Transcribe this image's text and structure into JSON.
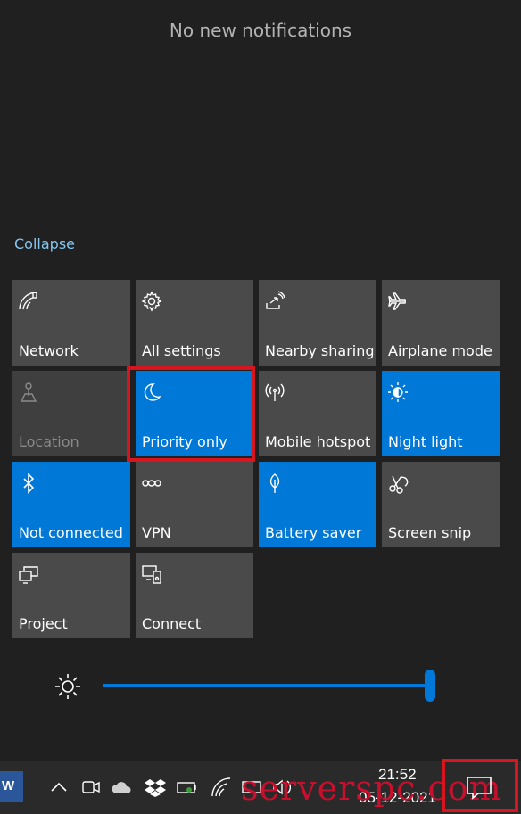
{
  "notifications": {
    "empty_text": "No new notifications"
  },
  "action_center": {
    "collapse_label": "Collapse"
  },
  "quick_actions": [
    {
      "label": "Network",
      "icon": "network-icon",
      "state": "off"
    },
    {
      "label": "All settings",
      "icon": "gear-icon",
      "state": "off"
    },
    {
      "label": "Nearby sharing",
      "icon": "nearby-sharing-icon",
      "state": "off"
    },
    {
      "label": "Airplane mode",
      "icon": "airplane-icon",
      "state": "off"
    },
    {
      "label": "Location",
      "icon": "location-icon",
      "state": "disabled"
    },
    {
      "label": "Priority only",
      "icon": "moon-icon",
      "state": "on"
    },
    {
      "label": "Mobile hotspot",
      "icon": "hotspot-icon",
      "state": "off"
    },
    {
      "label": "Night light",
      "icon": "night-light-icon",
      "state": "on"
    },
    {
      "label": "Not connected",
      "icon": "bluetooth-icon",
      "state": "on"
    },
    {
      "label": "VPN",
      "icon": "vpn-icon",
      "state": "off"
    },
    {
      "label": "Battery saver",
      "icon": "battery-saver-icon",
      "state": "on"
    },
    {
      "label": "Screen snip",
      "icon": "screen-snip-icon",
      "state": "off"
    },
    {
      "label": "Project",
      "icon": "project-icon",
      "state": "off"
    },
    {
      "label": "Connect",
      "icon": "connect-icon",
      "state": "off"
    }
  ],
  "brightness": {
    "icon": "brightness-icon",
    "level": 1.0
  },
  "taskbar": {
    "word_label": "W",
    "time": "21:52",
    "date": "05-12-2021",
    "icons": [
      "chevron-up-icon",
      "meet-now-icon",
      "onedrive-icon",
      "dropbox-icon",
      "battery-icon",
      "wifi-icon",
      "keyboard-icon",
      "volume-icon",
      "action-center-icon"
    ]
  },
  "watermark": "serverspc.com",
  "colors": {
    "background": "#202020",
    "tile_off": "#4a4a4a",
    "tile_on": "#0078d7",
    "accent_link": "#86c6ee",
    "highlight": "#d7151f"
  }
}
